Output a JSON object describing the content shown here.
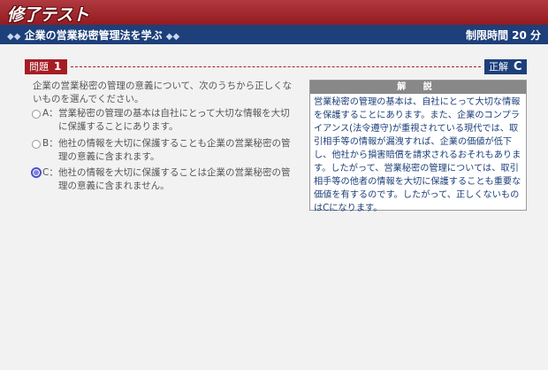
{
  "header": {
    "title": "修了テスト"
  },
  "subheader": {
    "diamonds_left": "◆◆",
    "course_title": "企業の営業秘密管理法を学ぶ",
    "diamonds_right": "◆◆",
    "time_limit": "制限時間 20 分"
  },
  "question": {
    "label": "問題",
    "number": "1",
    "text": "企業の営業秘密の管理の意義について、次のうちから正しくないものを選んでください。"
  },
  "answer": {
    "label": "正解",
    "value": "C"
  },
  "choices": [
    {
      "letter": "A：",
      "text": "営業秘密の管理の基本は自社にとって大切な情報を大切に保護することにあります。",
      "selected": false
    },
    {
      "letter": "B：",
      "text": "他社の情報を大切に保護することも企業の営業秘密の管理の意義に含まれます。",
      "selected": false
    },
    {
      "letter": "C：",
      "text": "他社の情報を大切に保護することは企業の営業秘密の管理の意義に含まれません。",
      "selected": true
    }
  ],
  "explanation": {
    "title": "解 説",
    "body": "営業秘密の管理の基本は、自社にとって大切な情報を保護することにあります。また、企業のコンプライアンス(法令遵守)が重視されている現代では、取引相手等の情報が漏洩すれば、企業の価値が低下し、他社から損害賠償を請求されるおそれもあります。したがって、営業秘密の管理については、取引相手等の他者の情報を大切に保護することも重要な価値を有するのです。したがって、正しくないものはCになります。"
  }
}
